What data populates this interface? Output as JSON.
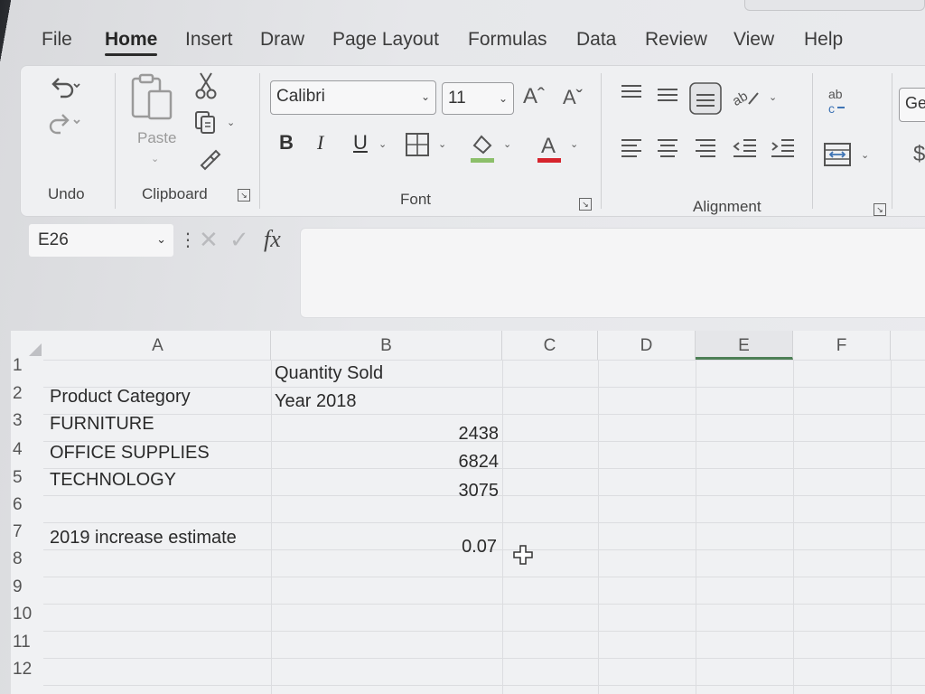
{
  "menu": {
    "tabs": [
      "File",
      "Home",
      "Insert",
      "Draw",
      "Page Layout",
      "Formulas",
      "Data",
      "Review",
      "View",
      "Help"
    ],
    "active": "Home"
  },
  "ribbon": {
    "groups": {
      "undo": "Undo",
      "clipboard": "Clipboard",
      "font": "Font",
      "alignment": "Alignment"
    },
    "paste_label": "Paste",
    "font_name": "Calibri",
    "font_size": "11",
    "number_format_partial": "Ger",
    "format_buttons": {
      "bold": "B",
      "italic": "I",
      "underline": "U"
    },
    "icons": [
      "undo-icon",
      "redo-icon",
      "paste-icon",
      "cut-icon",
      "copy-icon",
      "format-painter-icon",
      "increase-font-icon",
      "decrease-font-icon",
      "borders-icon",
      "fill-color-icon",
      "font-color-icon",
      "align-top-icon",
      "align-middle-icon",
      "align-bottom-icon",
      "orientation-icon",
      "wrap-text-icon",
      "align-left-icon",
      "align-center-icon",
      "align-right-icon",
      "decrease-indent-icon",
      "increase-indent-icon",
      "merge-center-icon",
      "currency-icon"
    ],
    "colors": {
      "fill_accent": "#8cbf6a",
      "font_accent": "#d6242d"
    }
  },
  "formula_bar": {
    "name_box": "E26",
    "fx_label": "fx",
    "content": ""
  },
  "sheet": {
    "columns": [
      "A",
      "B",
      "C",
      "D",
      "E",
      "F"
    ],
    "selected_column": "E",
    "rows": [
      "1",
      "2",
      "3",
      "4",
      "5",
      "6",
      "7",
      "8",
      "9",
      "10",
      "11",
      "12"
    ],
    "cells": {
      "B1": "Quantity Sold",
      "A2": "Product Category",
      "B2": "Year 2018",
      "A3": "FURNITURE",
      "B3": "2438",
      "A4": "OFFICE SUPPLIES",
      "B4": "6824",
      "A5": "TECHNOLOGY",
      "B5": "3075",
      "A7": "2019 increase estimate",
      "B7": "0.07"
    }
  }
}
